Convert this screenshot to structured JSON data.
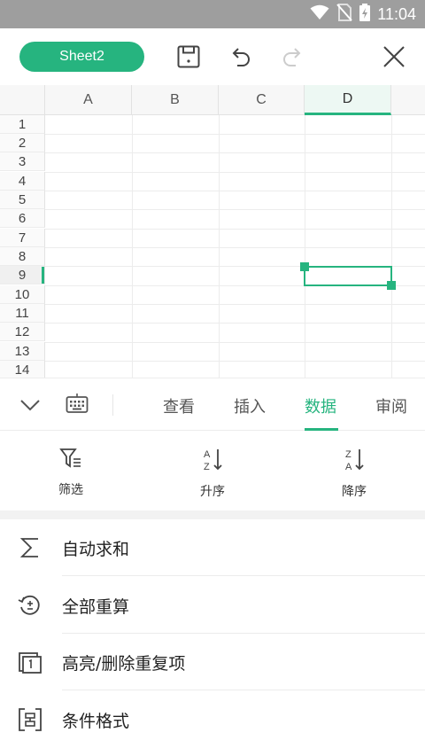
{
  "status_bar": {
    "time": "11:04"
  },
  "toolbar": {
    "sheet_label": "Sheet2"
  },
  "grid": {
    "columns": [
      "A",
      "B",
      "C",
      "D"
    ],
    "rows": [
      "1",
      "2",
      "3",
      "4",
      "5",
      "6",
      "7",
      "8",
      "9",
      "10",
      "11",
      "12",
      "13",
      "14"
    ],
    "selected_column": "D",
    "selected_row": "9"
  },
  "tabs": [
    {
      "label": "查看"
    },
    {
      "label": "插入"
    },
    {
      "label": "数据"
    },
    {
      "label": "审阅"
    }
  ],
  "active_tab": "数据",
  "quick_actions": [
    {
      "label": "筛选",
      "icon": "filter-icon"
    },
    {
      "label": "升序",
      "icon": "sort-ascending-icon"
    },
    {
      "label": "降序",
      "icon": "sort-descending-icon"
    }
  ],
  "menu_items": [
    {
      "label": "自动求和",
      "icon": "sigma-icon"
    },
    {
      "label": "全部重算",
      "icon": "recalculate-icon"
    },
    {
      "label": "高亮/删除重复项",
      "icon": "duplicates-icon"
    },
    {
      "label": "条件格式",
      "icon": "conditional-format-icon"
    }
  ],
  "colors": {
    "accent": "#26b47f",
    "status_bar": "#9e9e9e"
  }
}
